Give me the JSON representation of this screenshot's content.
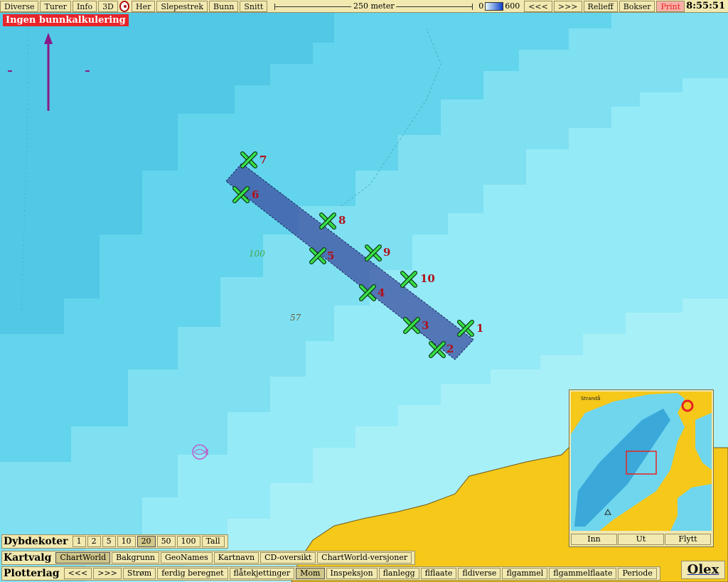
{
  "toolbar": {
    "left_buttons": [
      "Diverse",
      "Turer",
      "Info",
      "3D"
    ],
    "mid_buttons": [
      "Her",
      "Slepestrek",
      "Bunn",
      "Snitt"
    ],
    "scale_label": "250 meter",
    "depth_min": "0",
    "depth_max": "600",
    "right_buttons": [
      "<<<",
      ">>>",
      "Relieff",
      "Bokser"
    ],
    "print_label": "Print",
    "clock": "8:55:51"
  },
  "status_label": "Ingen bunnkalkulering",
  "depth_labels": [
    "100",
    "57"
  ],
  "waypoints": [
    {
      "label": "1"
    },
    {
      "label": "2"
    },
    {
      "label": "3"
    },
    {
      "label": "4"
    },
    {
      "label": "5"
    },
    {
      "label": "6"
    },
    {
      "label": "7"
    },
    {
      "label": "8"
    },
    {
      "label": "9"
    },
    {
      "label": "10"
    }
  ],
  "dybdekoter": {
    "title": "Dybdekoter",
    "options": [
      "1",
      "2",
      "5",
      "10",
      "20",
      "50",
      "100",
      "Tall"
    ],
    "active": "20"
  },
  "kartvalg": {
    "title": "Kartvalg",
    "options": [
      "ChartWorld",
      "Bakgrunn",
      "GeoNames",
      "Kartnavn",
      "CD-oversikt",
      "ChartWorld-versjoner"
    ],
    "active": "ChartWorld"
  },
  "plotterlag": {
    "title": "Plotterlag",
    "options": [
      "<<<",
      ">>>",
      "Strøm",
      "ferdig beregnet",
      "flåtekjettinger",
      "Mom",
      "Inspeksjon",
      "flanlegg",
      "flflaate",
      "fldiverse",
      "flgammel",
      "flgammelflaate",
      "Periode"
    ],
    "active": "Mom"
  },
  "minimap": {
    "place_name": "Strandå",
    "buttons": [
      "Inn",
      "Ut",
      "Flytt"
    ]
  },
  "brand": "Olex",
  "colors": {
    "deep": "#5acde8",
    "mid": "#7fe0f2",
    "shallow": "#a8f0f8",
    "land": "#f5c81a",
    "rect_fill": "#3d4fa0",
    "waypoint": "#38e048",
    "waypoint_label": "#b0101a"
  }
}
